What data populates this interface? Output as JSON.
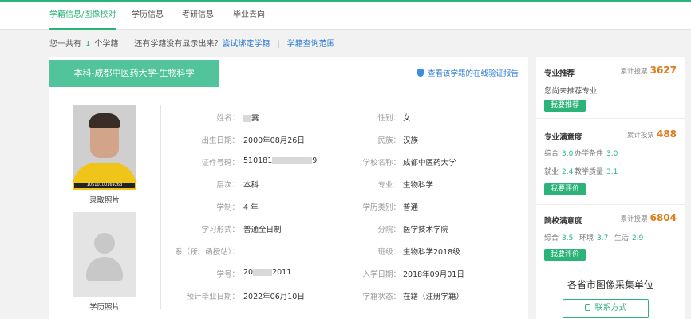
{
  "nav": {
    "tabs": [
      {
        "label": "学籍信息/图像校对",
        "active": true
      },
      {
        "label": "学历信息",
        "active": false
      },
      {
        "label": "考研信息",
        "active": false
      },
      {
        "label": "毕业去向",
        "active": false
      }
    ]
  },
  "infobar": {
    "prefix": "您一共有",
    "count": "1",
    "suffix": "个学籍",
    "question": "还有学籍没有显示出来？",
    "bind_link": "尝试绑定学籍",
    "sep": "|",
    "scope_link": "学籍查询范围"
  },
  "record": {
    "banner": "本科-成都中医药大学-生物科学",
    "verify_link": "查看该学籍的在线验证报告",
    "photo1_caption": "录取照片",
    "photo1_id": "10510100169263",
    "photo2_caption": "学历照片",
    "fields_left": [
      {
        "label": "姓名：",
        "value": "霙"
      },
      {
        "label": "出生日期：",
        "value": "2000年08月26日"
      },
      {
        "label": "证件号码：",
        "value_start": "510181",
        "value_end": "9"
      },
      {
        "label": "层次：",
        "value": "本科"
      },
      {
        "label": "学制：",
        "value": "4 年"
      },
      {
        "label": "学习形式：",
        "value": "普通全日制"
      },
      {
        "label": "系（所、函授站）：",
        "value": ""
      },
      {
        "label": "学号：",
        "value_start": "20",
        "value_end": "2011"
      },
      {
        "label": "预计毕业日期：",
        "value": "2022年06月10日"
      }
    ],
    "fields_right": [
      {
        "label": "性别：",
        "value": "女"
      },
      {
        "label": "民族：",
        "value": "汉族"
      },
      {
        "label": "学校名称：",
        "value": "成都中医药大学"
      },
      {
        "label": "专业：",
        "value": "生物科学"
      },
      {
        "label": "学历类别：",
        "value": "普通"
      },
      {
        "label": "分院：",
        "value": "医学技术学院"
      },
      {
        "label": "班级：",
        "value": "生物科学2018级"
      },
      {
        "label": "入学日期：",
        "value": "2018年09月01日"
      },
      {
        "label": "学籍状态：",
        "value": "在籍（注册学籍）"
      }
    ]
  },
  "sidebar": {
    "recommend": {
      "title": "专业推荐",
      "votes_label": "累计投票",
      "votes": "3627",
      "note": "您尚未推荐专业",
      "button": "我要推荐"
    },
    "major_satisfaction": {
      "title": "专业满意度",
      "votes_label": "累计投票",
      "votes": "488",
      "scores": [
        {
          "label": "综合",
          "value": "3.0"
        },
        {
          "label": "办学条件",
          "value": "3.0"
        },
        {
          "label": "就业",
          "value": "2.4"
        },
        {
          "label": "教学质量",
          "value": "3.1"
        }
      ],
      "button": "我要评价"
    },
    "school_satisfaction": {
      "title": "院校满意度",
      "votes_label": "累计投票",
      "votes": "6804",
      "scores": [
        {
          "label": "综合",
          "value": "3.5"
        },
        {
          "label": "环境",
          "value": "3.7"
        },
        {
          "label": "生活",
          "value": "2.9"
        }
      ],
      "button": "我要评价"
    },
    "collect_title": "各省市图像采集单位",
    "contact_button": "联系方式"
  },
  "colors": {
    "accent": "#2bb37a",
    "banner": "#52c49b",
    "link": "#2b7bd1",
    "votes": "#e07b1a"
  }
}
